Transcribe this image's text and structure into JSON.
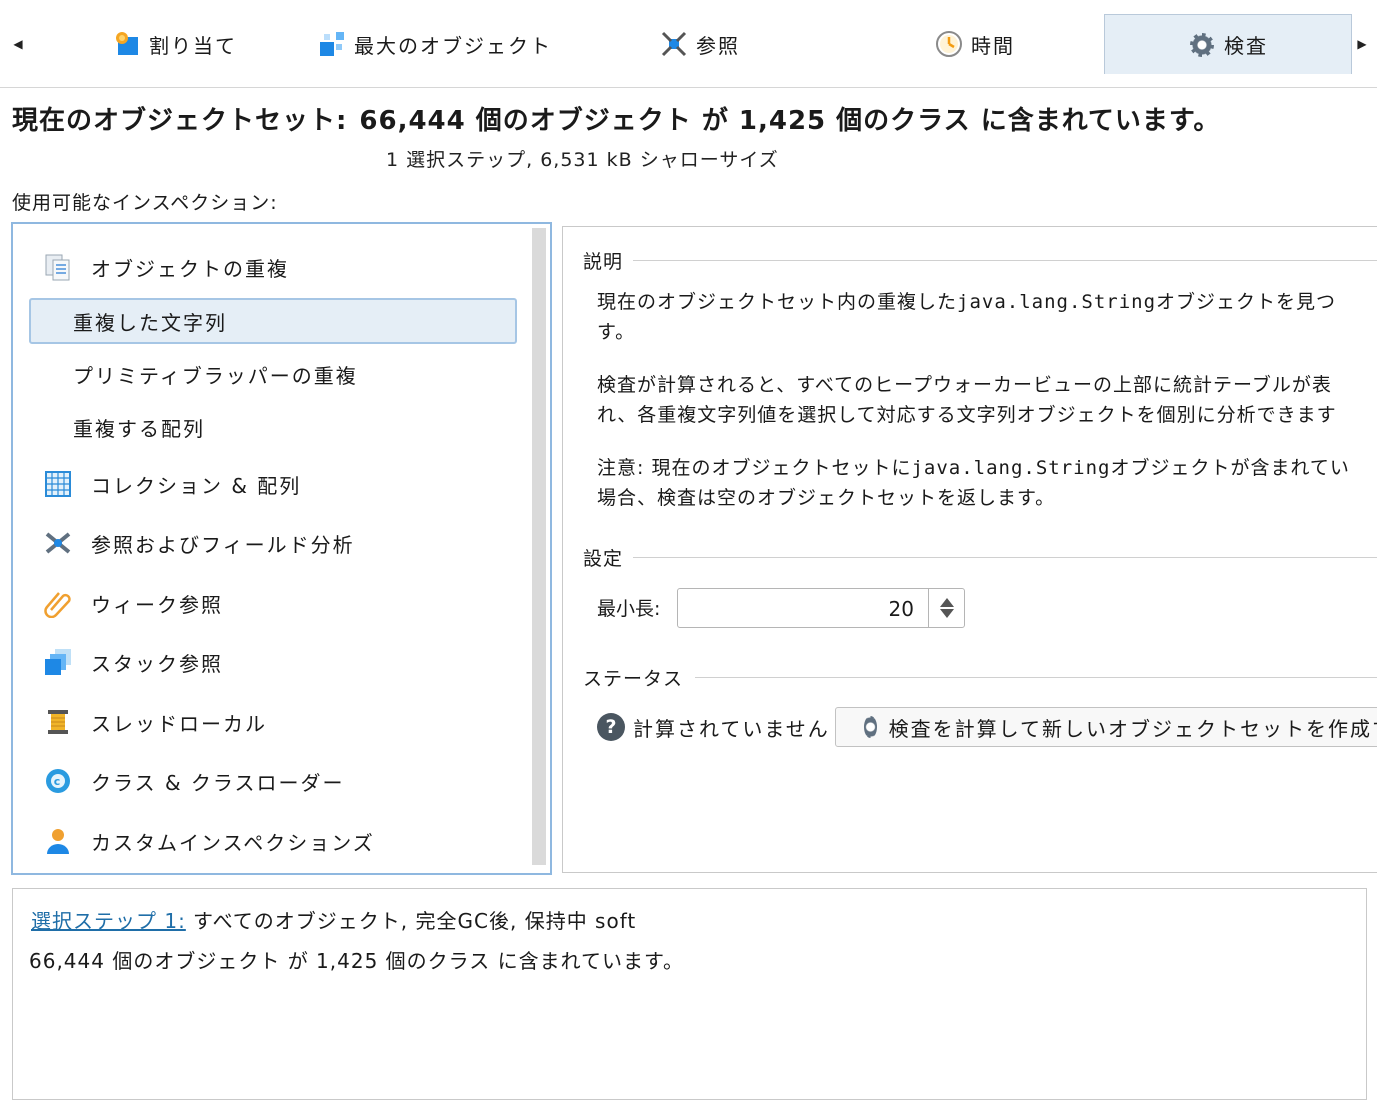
{
  "tabs": [
    {
      "label": "割り当て",
      "icon": "allocation-icon"
    },
    {
      "label": "最大のオブジェクト",
      "icon": "biggest-objects-icon"
    },
    {
      "label": "参照",
      "icon": "references-icon"
    },
    {
      "label": "時間",
      "icon": "clock-icon"
    },
    {
      "label": "検査",
      "icon": "gear-icon",
      "active": true
    }
  ],
  "heading": {
    "title": "現在のオブジェクトセット:",
    "summary": "66,444 個のオブジェクト が 1,425 個のクラス に含まれています。",
    "subtitle": "1 選択ステップ, 6,531 kB シャローサイズ"
  },
  "inspections_label": "使用可能なインスペクション:",
  "inspections": {
    "duplicates": {
      "label": "オブジェクトの重複",
      "icon": "duplicate-objects-icon"
    },
    "duplicate_strings": {
      "label": "重複した文字列",
      "selected": true
    },
    "duplicate_wrappers": {
      "label": "プリミティブラッパーの重複"
    },
    "duplicate_arrays": {
      "label": "重複する配列"
    },
    "collections": {
      "label": "コレクション & 配列",
      "icon": "table-icon"
    },
    "references": {
      "label": "参照およびフィールド分析",
      "icon": "references-icon"
    },
    "weak_refs": {
      "label": "ウィーク参照",
      "icon": "paperclip-icon"
    },
    "stack_refs": {
      "label": "スタック参照",
      "icon": "stack-icon"
    },
    "thread_local": {
      "label": "スレッドローカル",
      "icon": "spool-icon"
    },
    "classes": {
      "label": "クラス & クラスローダー",
      "icon": "class-icon"
    },
    "custom": {
      "label": "カスタムインスペクションズ",
      "icon": "user-icon"
    }
  },
  "details": {
    "description_title": "説明",
    "desc1_a": "現在のオブジェクトセット内の重複した",
    "desc1_code": "java.lang.String",
    "desc1_b": "オブジェクトを見つ",
    "desc1_c": "す。",
    "desc2_a": "検査が計算されると、すべてのヒープウォーカービューの上部に統計テーブルが表",
    "desc2_b": "れ、各重複文字列値を選択して対応する文字列オブジェクトを個別に分析できます",
    "desc3_a": "注意: 現在のオブジェクトセットに",
    "desc3_code": "java.lang.String",
    "desc3_b": "オブジェクトが含まれてい",
    "desc3_c": "場合、検査は空のオブジェクトセットを返します。",
    "settings_title": "設定",
    "min_length_label": "最小長:",
    "min_length_value": "20",
    "status_title": "ステータス",
    "status_text": "計算されていません",
    "compute_button": "検査を計算して新しいオブジェクトセットを作成す"
  },
  "bottom": {
    "step_link": "選択ステップ 1:",
    "step_desc": "すべてのオブジェクト, 完全GC後, 保持中 soft",
    "summary": "66,444 個のオブジェクト が 1,425 個のクラス に含まれています。"
  },
  "colors": {
    "accent_selected_bg": "#e5eef6",
    "accent_border": "#8fb8e0",
    "link": "#1f6ea8"
  }
}
